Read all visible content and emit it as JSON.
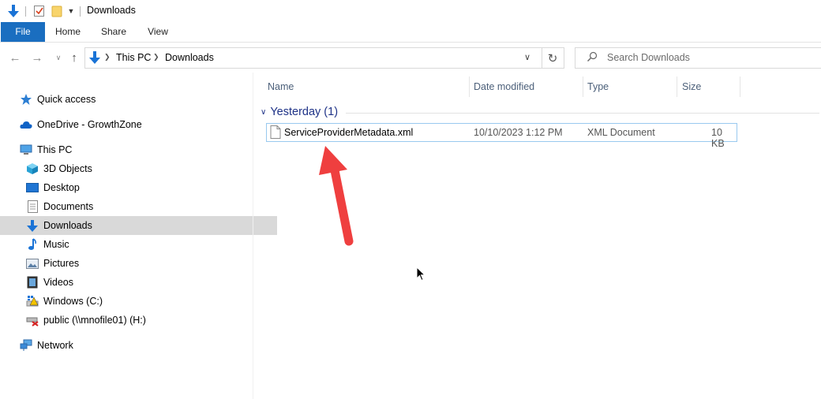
{
  "window": {
    "title": "Downloads"
  },
  "ribbon": {
    "tabs": [
      "File",
      "Home",
      "Share",
      "View"
    ]
  },
  "address": {
    "breadcrumb": [
      "This PC",
      "Downloads"
    ],
    "search_placeholder": "Search Downloads"
  },
  "sidebar": {
    "items": [
      {
        "label": "Quick access",
        "icon": "star-icon"
      },
      {
        "label": "OneDrive - GrowthZone",
        "icon": "cloud-icon"
      },
      {
        "label": "This PC",
        "icon": "computer-icon"
      },
      {
        "label": "3D Objects",
        "icon": "cube-icon"
      },
      {
        "label": "Desktop",
        "icon": "desktop-icon"
      },
      {
        "label": "Documents",
        "icon": "document-icon"
      },
      {
        "label": "Downloads",
        "icon": "download-icon",
        "selected": true
      },
      {
        "label": "Music",
        "icon": "music-icon"
      },
      {
        "label": "Pictures",
        "icon": "pictures-icon"
      },
      {
        "label": "Videos",
        "icon": "video-icon"
      },
      {
        "label": "Windows (C:)",
        "icon": "drive-icon"
      },
      {
        "label": "public (\\\\mnofile01) (H:)",
        "icon": "network-drive-disconnected-icon"
      },
      {
        "label": "Network",
        "icon": "network-icon"
      }
    ]
  },
  "columns": {
    "name": "Name",
    "date_modified": "Date modified",
    "type": "Type",
    "size": "Size"
  },
  "group": {
    "label": "Yesterday (1)"
  },
  "files": [
    {
      "name": "ServiceProviderMetadata.xml",
      "date_modified": "10/10/2023 1:12 PM",
      "type": "XML Document",
      "size": "10 KB"
    }
  ],
  "colors": {
    "accent": "#1a6ec0",
    "annotation_arrow": "#ef3f3f",
    "group_header": "#1e3287",
    "selection": "#d9d9d9"
  }
}
